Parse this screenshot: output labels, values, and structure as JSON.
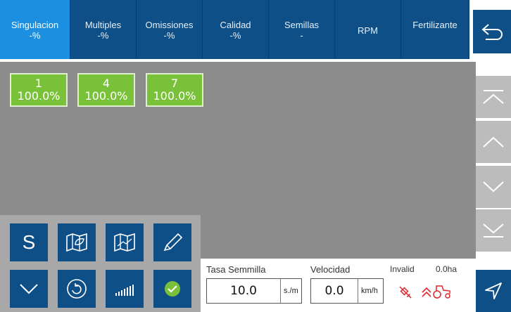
{
  "tabs": [
    {
      "label": "Singulacion",
      "sub": "-%",
      "active": true
    },
    {
      "label": "Multiples",
      "sub": "-%"
    },
    {
      "label": "Omissiones",
      "sub": "-%"
    },
    {
      "label": "Calidad",
      "sub": "-%"
    },
    {
      "label": "Semillas",
      "sub": "-"
    },
    {
      "label": "RPM",
      "sub": ""
    },
    {
      "label": "Fertilizante",
      "sub": ""
    }
  ],
  "rows": [
    {
      "number": "1",
      "value": "100.0%"
    },
    {
      "number": "4",
      "value": "100.0%"
    },
    {
      "number": "7",
      "value": "100.0%"
    }
  ],
  "grid": {
    "s_label": "S"
  },
  "status": {
    "rate_label": "Tasa Semmilla",
    "rate_value": "10.0",
    "rate_unit": "s./m",
    "speed_label": "Velocidad",
    "speed_value": "0.0",
    "speed_unit": "km/h",
    "gps_status": "Invalid",
    "area": "0.0ha"
  },
  "colors": {
    "primary": "#0d4f86",
    "active_tab": "#1c8fe0",
    "panel": "#8c8c8c",
    "row_ok": "#7ac13a",
    "alert": "#e0262b",
    "check": "#7ac13a"
  }
}
